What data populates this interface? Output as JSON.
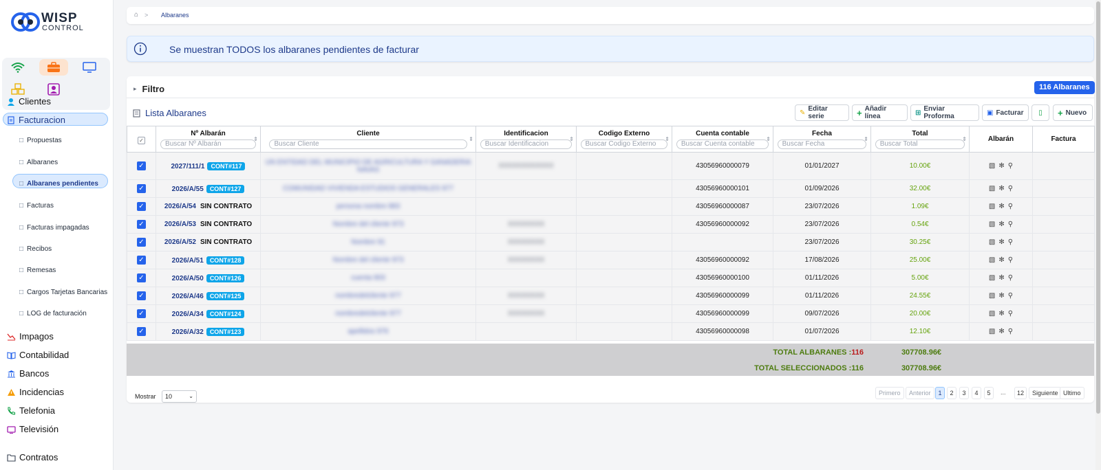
{
  "brand": {
    "name_top": "WISP",
    "name_bottom": "CONTROL"
  },
  "apps": [
    "wifi-icon",
    "briefcase-icon",
    "monitor-icon",
    "boxes-icon",
    "user-badge-icon"
  ],
  "sidebar": {
    "top_items": [
      {
        "label": "Clientes",
        "icon": "user-icon"
      },
      {
        "label": "Facturacion",
        "icon": "invoice-icon",
        "active": true
      }
    ],
    "sub_items": [
      {
        "label": "Propuestas"
      },
      {
        "label": "Albaranes"
      },
      {
        "label": "Albaranes pendientes",
        "active": true
      },
      {
        "label": "Facturas"
      },
      {
        "label": "Facturas impagadas"
      },
      {
        "label": "Recibos"
      },
      {
        "label": "Remesas"
      },
      {
        "label": "Cargos Tarjetas Bancarias"
      },
      {
        "label": "LOG de facturación"
      }
    ],
    "bottom_items": [
      {
        "label": "Impagos",
        "icon": "chart-down-icon"
      },
      {
        "label": "Contabilidad",
        "icon": "book-icon"
      },
      {
        "label": "Bancos",
        "icon": "bank-icon"
      },
      {
        "label": "Incidencias",
        "icon": "warning-icon"
      },
      {
        "label": "Telefonia",
        "icon": "phone-icon"
      },
      {
        "label": "Televisión",
        "icon": "tv-icon"
      },
      {
        "label": "Contratos",
        "icon": "folder-icon"
      }
    ]
  },
  "breadcrumb": {
    "separator": ">",
    "current": "Albaranes"
  },
  "alert": {
    "text": "Se muestran TODOS los albaranes pendientes de facturar"
  },
  "filter": {
    "label": "Filtro",
    "count_badge": "116 Albaranes"
  },
  "list": {
    "title": "Lista Albaranes",
    "buttons": {
      "edit_series": "Editar serie",
      "add_line": "Añadir línea",
      "send_proforma": "Enviar Proforma",
      "invoice": "Facturar",
      "new": "Nuevo"
    }
  },
  "table": {
    "headers": {
      "numero": "Nº Albarán",
      "cliente": "Cliente",
      "identificacion": "Identificacion",
      "codigo": "Codigo Externo",
      "cuenta": "Cuenta contable",
      "fecha": "Fecha",
      "total": "Total",
      "albaran": "Albarán",
      "factura": "Factura"
    },
    "placeholders": {
      "numero": "Buscar Nº Albarán",
      "cliente": "Buscar Cliente",
      "identificacion": "Buscar Identificacion",
      "codigo": "Buscar Codigo Externo",
      "cuenta": "Buscar Cuenta contable",
      "fecha": "Buscar Fecha",
      "total": "Buscar Total"
    },
    "rows": [
      {
        "num": "2027/111/1",
        "badge": "CONT#117",
        "cliente": "UN ENTIDAD DEL MUNICIPIO DE AGRICULTURA Y GANADERIA NAVAS",
        "id": "XXXXXXXXXXXX",
        "cuenta": "43056960000079",
        "fecha": "01/01/2027",
        "total": "10.00€"
      },
      {
        "num": "2026/A/55",
        "badge": "CONT#127",
        "cliente": "COMUNIDAD VIVIENDA ESTUDIOS GENERALES 977",
        "id": "",
        "cuenta": "43056960000101",
        "fecha": "01/09/2026",
        "total": "32.00€"
      },
      {
        "num": "2026/A/54",
        "badge": "SIN CONTRATO",
        "cliente": "persona nombre 883",
        "id": "",
        "cuenta": "43056960000087",
        "fecha": "23/07/2026",
        "total": "1.09€"
      },
      {
        "num": "2026/A/53",
        "badge": "SIN CONTRATO",
        "cliente": "Nombre del cliente 973",
        "id": "XXXXXXXX",
        "cuenta": "43056960000092",
        "fecha": "23/07/2026",
        "total": "0.54€"
      },
      {
        "num": "2026/A/52",
        "badge": "SIN CONTRATO",
        "cliente": "Nombre 91",
        "id": "XXXXXXXX",
        "cuenta": "",
        "fecha": "23/07/2026",
        "total": "30.25€"
      },
      {
        "num": "2026/A/51",
        "badge": "CONT#128",
        "cliente": "Nombre del cliente 973",
        "id": "XXXXXXXX",
        "cuenta": "43056960000092",
        "fecha": "17/08/2026",
        "total": "25.00€"
      },
      {
        "num": "2026/A/50",
        "badge": "CONT#126",
        "cliente": "cuenta 903",
        "id": "",
        "cuenta": "43056960000100",
        "fecha": "01/11/2026",
        "total": "5.00€"
      },
      {
        "num": "2026/A/46",
        "badge": "CONT#125",
        "cliente": "nombredelcliente 977",
        "id": "XXXXXXXX",
        "cuenta": "43056960000099",
        "fecha": "01/11/2026",
        "total": "24.55€"
      },
      {
        "num": "2026/A/34",
        "badge": "CONT#124",
        "cliente": "nombredelcliente 977",
        "id": "XXXXXXXX",
        "cuenta": "43056960000099",
        "fecha": "09/07/2026",
        "total": "20.00€"
      },
      {
        "num": "2026/A/32",
        "badge": "CONT#123",
        "cliente": "apellidos 976",
        "id": "",
        "cuenta": "43056960000098",
        "fecha": "01/07/2026",
        "total": "12.10€"
      }
    ]
  },
  "totals": {
    "albaranes_label": "TOTAL ALBARANES :",
    "albaranes_count": "116",
    "albaranes_amount": "307708.96€",
    "seleccionados_label": "TOTAL SELECCIONADOS :116",
    "seleccionados_amount": "307708.96€"
  },
  "pagination": {
    "show_label": "Mostrar",
    "page_size": "10",
    "first": "Primero",
    "prev": "Anterior",
    "pages": [
      "1",
      "2",
      "3",
      "4",
      "5"
    ],
    "ellipsis": "...",
    "last_page": "12",
    "next": "Siguiente",
    "last": "Ultimo"
  },
  "colors": {
    "accent": "#2563eb",
    "badge": "#0ea5e9",
    "total_green": "#65a30d",
    "active_nav": "#dbeafe"
  }
}
